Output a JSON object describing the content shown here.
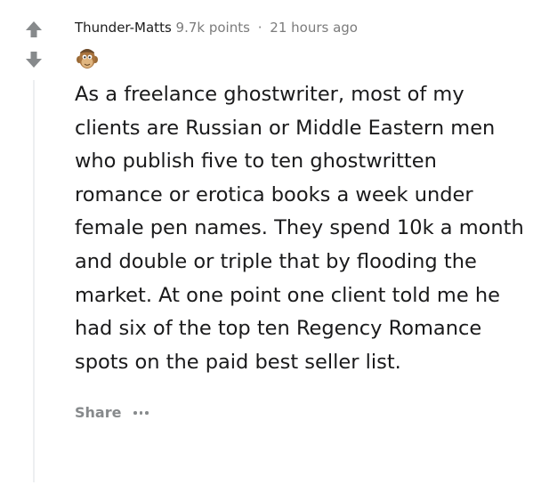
{
  "comment": {
    "author": "Thunder-Matts",
    "points": "9.7k points",
    "separator": "·",
    "time": "21 hours ago",
    "body": "As a freelance ghostwriter, most of my clients are Russian or Middle Eastern men who publish five to ten ghostwritten romance or erotica books a week under female pen names. They spend 10k a month and double or triple that by flooding the market. At one point one client told me he had six of the top ten Regency Romance spots on the paid best seller list.",
    "share_label": "Share",
    "more_icon": "more-horizontal-icon",
    "upvote_icon": "upvote-arrow-icon",
    "downvote_icon": "downvote-arrow-icon",
    "avatar_icon": "user-avatar-icon"
  },
  "colors": {
    "author": "#1c1c1c",
    "meta": "#7c7c7c",
    "body": "#1a1a1b",
    "action": "#878a8c",
    "arrow": "#878a8c",
    "thread_line": "#edeff1"
  }
}
